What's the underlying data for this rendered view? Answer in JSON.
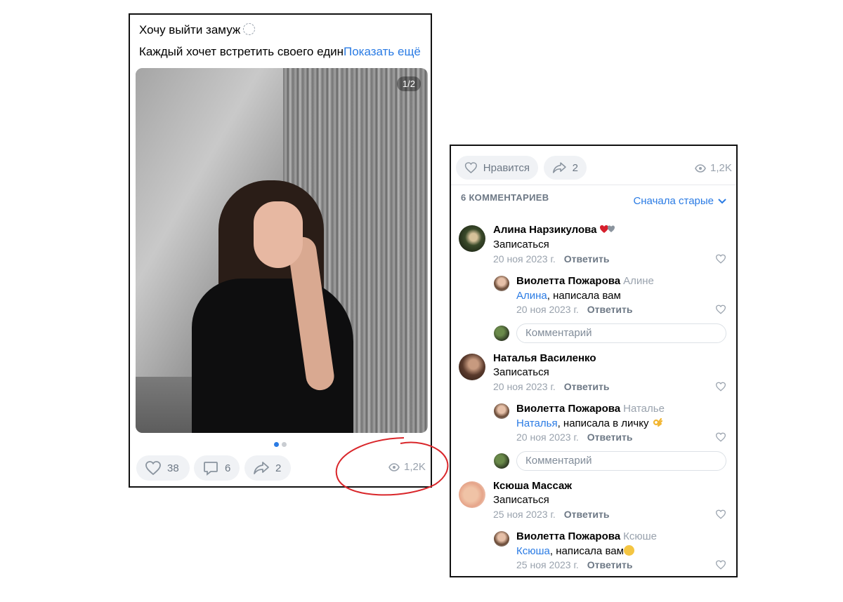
{
  "post": {
    "title": "Хочу выйти замуж",
    "text": "Каждый хочет встретить своего един",
    "show_more": "Показать ещё",
    "photo_counter": "1/2",
    "likes": "38",
    "comments": "6",
    "shares": "2",
    "views": "1,2K"
  },
  "comments_panel": {
    "like_label": "Нравится",
    "shares": "2",
    "views": "1,2K",
    "count_label": "6 КОММЕНТАРИЕВ",
    "sort_label": "Сначала старые",
    "input_placeholder": "Комментарий",
    "comments": [
      {
        "name": "Алина Нарзикулова",
        "text": "Записаться",
        "date": "20 ноя 2023 г.",
        "reply": "Ответить"
      },
      {
        "name": "Виолетта Пожарова",
        "addressee": "Алине",
        "mention": "Алина",
        "text": ", написала вам",
        "date": "20 ноя 2023 г.",
        "reply": "Ответить"
      },
      {
        "name": "Наталья Василенко",
        "text": "Записаться",
        "date": "20 ноя 2023 г.",
        "reply": "Ответить"
      },
      {
        "name": "Виолетта Пожарова",
        "addressee": "Наталье",
        "mention": "Наталья",
        "text": ", написала в личку",
        "date": "20 ноя 2023 г.",
        "reply": "Ответить"
      },
      {
        "name": "Ксюша Массаж",
        "text": "Записаться",
        "date": "25 ноя 2023 г.",
        "reply": "Ответить"
      },
      {
        "name": "Виолетта Пожарова",
        "addressee": "Ксюше",
        "mention": "Ксюша",
        "text": ", написала вам",
        "date": "25 ноя 2023 г.",
        "reply": "Ответить"
      }
    ]
  },
  "colors": {
    "accent": "#2a7be4",
    "muted": "#99a2ad",
    "annotation": "#d9262a"
  },
  "icons": [
    "heart-icon",
    "comment-icon",
    "share-icon",
    "eye-icon",
    "chevron-down-icon"
  ]
}
